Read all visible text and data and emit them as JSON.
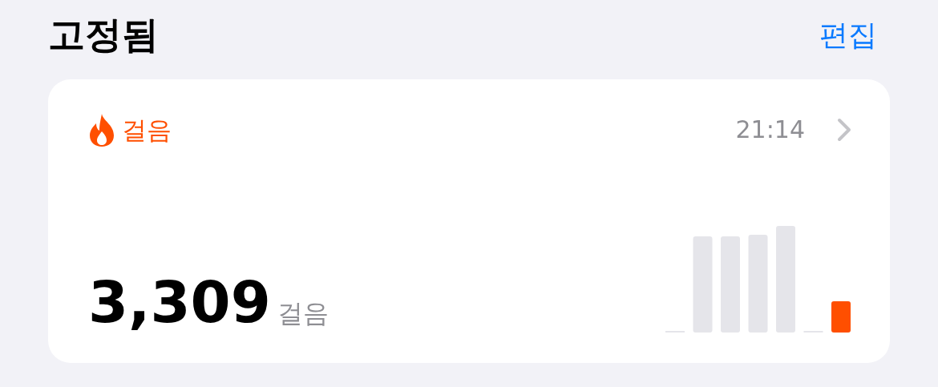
{
  "header": {
    "title": "고정됨",
    "edit_link": "편집"
  },
  "card": {
    "title": "걸음",
    "time": "21:14",
    "value": "3,309",
    "unit": "걸음"
  }
}
